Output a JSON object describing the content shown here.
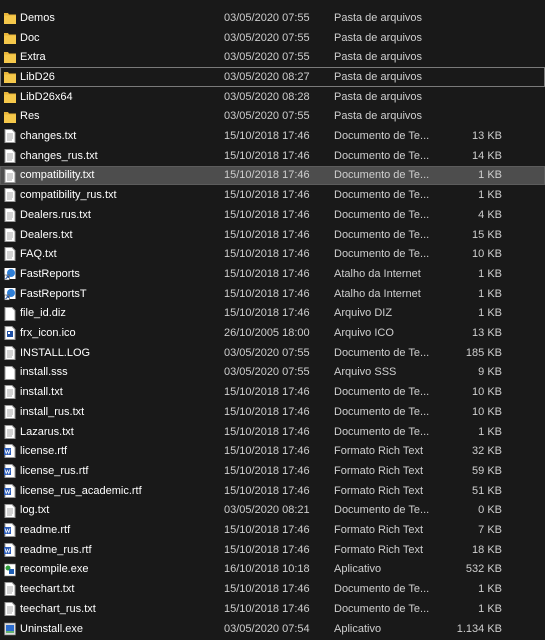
{
  "files": [
    {
      "name": "Demos",
      "date": "03/05/2020 07:55",
      "type": "Pasta de arquivos",
      "size": "",
      "icon": "folder-icon"
    },
    {
      "name": "Doc",
      "date": "03/05/2020 07:55",
      "type": "Pasta de arquivos",
      "size": "",
      "icon": "folder-icon"
    },
    {
      "name": "Extra",
      "date": "03/05/2020 07:55",
      "type": "Pasta de arquivos",
      "size": "",
      "icon": "folder-icon"
    },
    {
      "name": "LibD26",
      "date": "03/05/2020 08:27",
      "type": "Pasta de arquivos",
      "size": "",
      "icon": "folder-icon",
      "state": "focused"
    },
    {
      "name": "LibD26x64",
      "date": "03/05/2020 08:28",
      "type": "Pasta de arquivos",
      "size": "",
      "icon": "folder-icon"
    },
    {
      "name": "Res",
      "date": "03/05/2020 07:55",
      "type": "Pasta de arquivos",
      "size": "",
      "icon": "folder-icon"
    },
    {
      "name": "changes.txt",
      "date": "15/10/2018 17:46",
      "type": "Documento de Te...",
      "size": "13 KB",
      "icon": "text-file-icon"
    },
    {
      "name": "changes_rus.txt",
      "date": "15/10/2018 17:46",
      "type": "Documento de Te...",
      "size": "14 KB",
      "icon": "text-file-icon"
    },
    {
      "name": "compatibility.txt",
      "date": "15/10/2018 17:46",
      "type": "Documento de Te...",
      "size": "1 KB",
      "icon": "text-file-icon",
      "state": "selected"
    },
    {
      "name": "compatibility_rus.txt",
      "date": "15/10/2018 17:46",
      "type": "Documento de Te...",
      "size": "1 KB",
      "icon": "text-file-icon"
    },
    {
      "name": "Dealers.rus.txt",
      "date": "15/10/2018 17:46",
      "type": "Documento de Te...",
      "size": "4 KB",
      "icon": "text-file-icon"
    },
    {
      "name": "Dealers.txt",
      "date": "15/10/2018 17:46",
      "type": "Documento de Te...",
      "size": "15 KB",
      "icon": "text-file-icon"
    },
    {
      "name": "FAQ.txt",
      "date": "15/10/2018 17:46",
      "type": "Documento de Te...",
      "size": "10 KB",
      "icon": "text-file-icon"
    },
    {
      "name": "FastReports",
      "date": "15/10/2018 17:46",
      "type": "Atalho da Internet",
      "size": "1 KB",
      "icon": "internet-shortcut-icon"
    },
    {
      "name": "FastReportsT",
      "date": "15/10/2018 17:46",
      "type": "Atalho da Internet",
      "size": "1 KB",
      "icon": "internet-shortcut-icon"
    },
    {
      "name": "file_id.diz",
      "date": "15/10/2018 17:46",
      "type": "Arquivo DIZ",
      "size": "1 KB",
      "icon": "generic-file-icon"
    },
    {
      "name": "frx_icon.ico",
      "date": "26/10/2005 18:00",
      "type": "Arquivo ICO",
      "size": "13 KB",
      "icon": "ico-file-icon"
    },
    {
      "name": "INSTALL.LOG",
      "date": "03/05/2020 07:55",
      "type": "Documento de Te...",
      "size": "185 KB",
      "icon": "text-file-icon"
    },
    {
      "name": "install.sss",
      "date": "03/05/2020 07:55",
      "type": "Arquivo SSS",
      "size": "9 KB",
      "icon": "generic-file-icon"
    },
    {
      "name": "install.txt",
      "date": "15/10/2018 17:46",
      "type": "Documento de Te...",
      "size": "10 KB",
      "icon": "text-file-icon"
    },
    {
      "name": "install_rus.txt",
      "date": "15/10/2018 17:46",
      "type": "Documento de Te...",
      "size": "10 KB",
      "icon": "text-file-icon"
    },
    {
      "name": "Lazarus.txt",
      "date": "15/10/2018 17:46",
      "type": "Documento de Te...",
      "size": "1 KB",
      "icon": "text-file-icon"
    },
    {
      "name": "license.rtf",
      "date": "15/10/2018 17:46",
      "type": "Formato Rich Text",
      "size": "32 KB",
      "icon": "rtf-file-icon"
    },
    {
      "name": "license_rus.rtf",
      "date": "15/10/2018 17:46",
      "type": "Formato Rich Text",
      "size": "59 KB",
      "icon": "rtf-file-icon"
    },
    {
      "name": "license_rus_academic.rtf",
      "date": "15/10/2018 17:46",
      "type": "Formato Rich Text",
      "size": "51 KB",
      "icon": "rtf-file-icon"
    },
    {
      "name": "log.txt",
      "date": "03/05/2020 08:21",
      "type": "Documento de Te...",
      "size": "0 KB",
      "icon": "text-file-icon"
    },
    {
      "name": "readme.rtf",
      "date": "15/10/2018 17:46",
      "type": "Formato Rich Text",
      "size": "7 KB",
      "icon": "rtf-file-icon"
    },
    {
      "name": "readme_rus.rtf",
      "date": "15/10/2018 17:46",
      "type": "Formato Rich Text",
      "size": "18 KB",
      "icon": "rtf-file-icon"
    },
    {
      "name": "recompile.exe",
      "date": "16/10/2018 10:18",
      "type": "Aplicativo",
      "size": "532 KB",
      "icon": "application-icon"
    },
    {
      "name": "teechart.txt",
      "date": "15/10/2018 17:46",
      "type": "Documento de Te...",
      "size": "1 KB",
      "icon": "text-file-icon"
    },
    {
      "name": "teechart_rus.txt",
      "date": "15/10/2018 17:46",
      "type": "Documento de Te...",
      "size": "1 KB",
      "icon": "text-file-icon"
    },
    {
      "name": "Uninstall.exe",
      "date": "03/05/2020 07:54",
      "type": "Aplicativo",
      "size": "1.134 KB",
      "icon": "uninstall-app-icon"
    }
  ],
  "colors": {
    "background": "#191919",
    "text": "#ffffff",
    "secondary_text": "#cfcfcf",
    "selected_bg": "#4d4d4d",
    "folder": "#e8b53a"
  }
}
